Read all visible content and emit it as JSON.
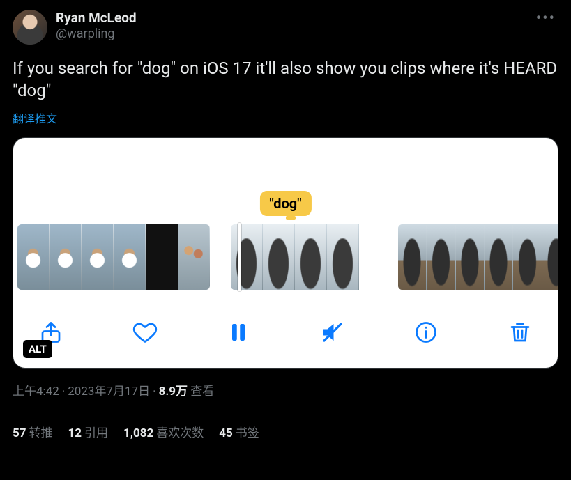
{
  "author": {
    "display_name": "Ryan McLeod",
    "handle": "@warpling"
  },
  "body_text": "If you search for \"dog\" on iOS 17 it'll also show you clips where it's HEARD \"dog\"",
  "translate_label": "翻译推文",
  "media": {
    "tooltip_label": "\"dog\"",
    "alt_badge": "ALT"
  },
  "meta": {
    "time": "上午4:42",
    "date": "2023年7月17日",
    "views_count": "8.9万",
    "views_label": "查看"
  },
  "stats": {
    "retweets_count": "57",
    "retweets_label": "转推",
    "quotes_count": "12",
    "quotes_label": "引用",
    "likes_count": "1,082",
    "likes_label": "喜欢次数",
    "bookmarks_count": "45",
    "bookmarks_label": "书签"
  }
}
